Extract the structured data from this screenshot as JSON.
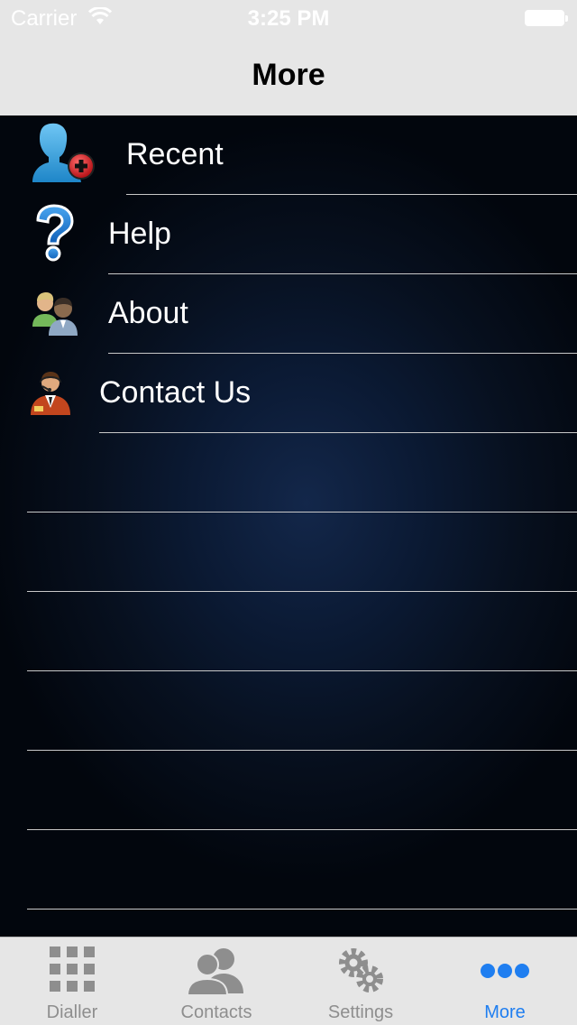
{
  "status_bar": {
    "carrier": "Carrier",
    "time": "3:25 PM"
  },
  "nav": {
    "title": "More"
  },
  "menu": {
    "items": [
      {
        "label": "Recent",
        "icon": "add-contact-icon"
      },
      {
        "label": "Help",
        "icon": "question-icon"
      },
      {
        "label": "About",
        "icon": "users-icon"
      },
      {
        "label": "Contact Us",
        "icon": "support-agent-icon"
      }
    ]
  },
  "tabbar": {
    "tabs": [
      {
        "label": "Dialler",
        "icon": "keypad-icon",
        "active": false
      },
      {
        "label": "Contacts",
        "icon": "contacts-icon",
        "active": false
      },
      {
        "label": "Settings",
        "icon": "gears-icon",
        "active": false
      },
      {
        "label": "More",
        "icon": "more-dots-icon",
        "active": true
      }
    ]
  },
  "colors": {
    "accent": "#1f7ef0",
    "inactive_tab": "#8e8e8e",
    "bar_background": "#e6e6e6",
    "content_background": "#07101f"
  }
}
